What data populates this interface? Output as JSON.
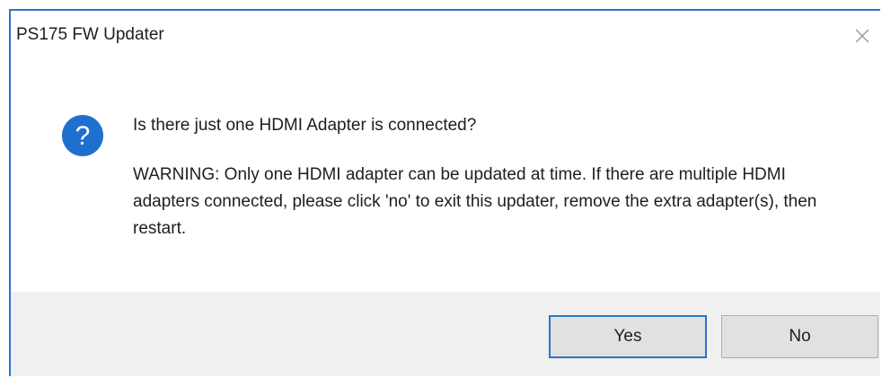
{
  "window": {
    "title": "PS175 FW Updater",
    "close_icon": "close-icon"
  },
  "message": {
    "icon": "question-icon",
    "question": "Is there just one HDMI Adapter is connected?",
    "warning": "WARNING:  Only one HDMI adapter can be updated at time. If there are multiple HDMI adapters connected, please click 'no' to exit this updater, remove the extra adapter(s), then restart."
  },
  "buttons": {
    "yes_label": "Yes",
    "no_label": "No"
  },
  "colors": {
    "accent": "#2b74c7",
    "footer_bg": "#f0f0f0",
    "button_bg": "#e1e1e1"
  }
}
